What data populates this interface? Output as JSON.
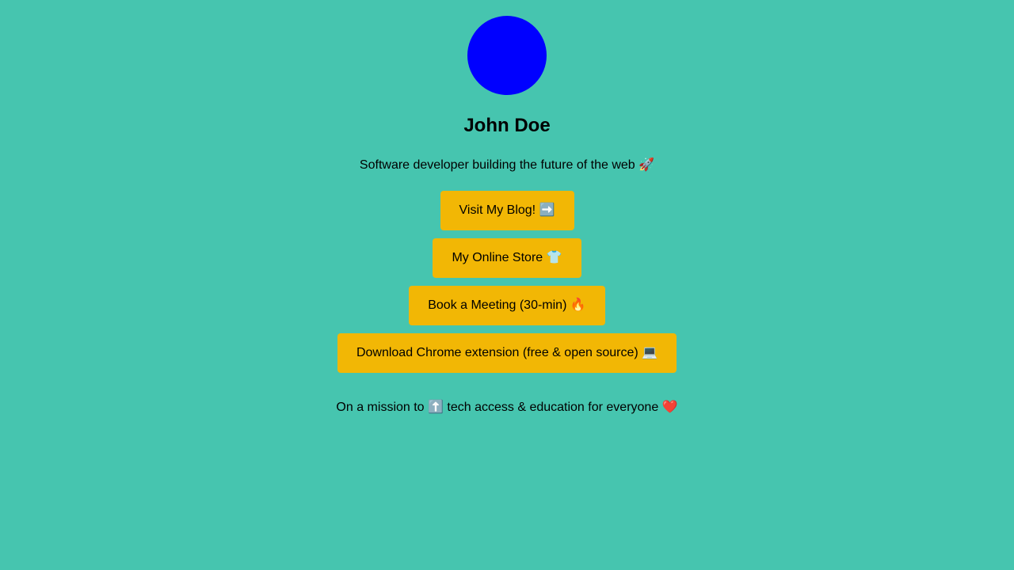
{
  "profile": {
    "avatar_color": "#0000ff",
    "name": "John Doe",
    "bio": "Software developer building the future of the web 🚀"
  },
  "links": [
    {
      "label": "Visit My Blog! ➡️"
    },
    {
      "label": "My Online Store 👕"
    },
    {
      "label": "Book a Meeting (30-min) 🔥"
    },
    {
      "label": "Download Chrome extension (free & open source) 💻"
    }
  ],
  "footer": {
    "mission": "On a mission to ⬆️ tech access & education for everyone ❤️"
  },
  "colors": {
    "background": "#46c5af",
    "button": "#f2b705",
    "text": "#000000"
  }
}
